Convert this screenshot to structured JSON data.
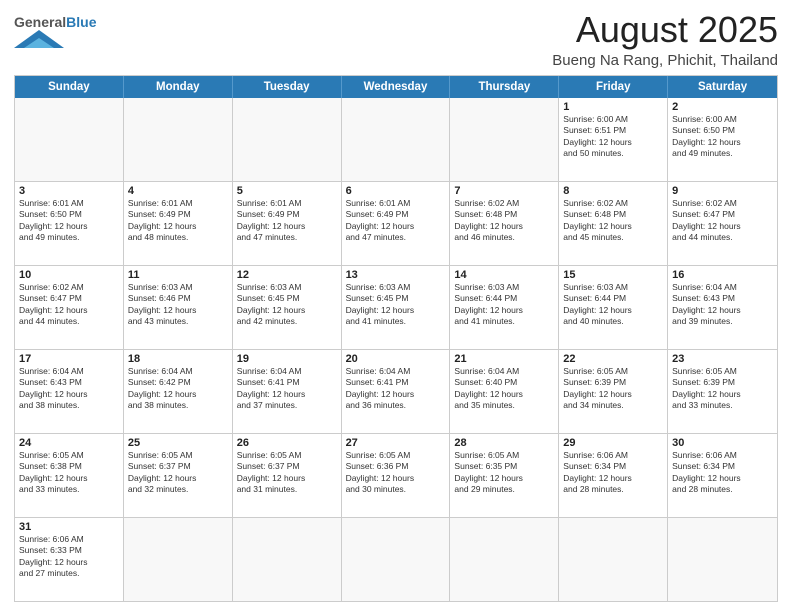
{
  "header": {
    "logo_general": "General",
    "logo_blue": "Blue",
    "month_year": "August 2025",
    "location": "Bueng Na Rang, Phichit, Thailand"
  },
  "weekdays": [
    "Sunday",
    "Monday",
    "Tuesday",
    "Wednesday",
    "Thursday",
    "Friday",
    "Saturday"
  ],
  "rows": [
    [
      {
        "day": "",
        "text": ""
      },
      {
        "day": "",
        "text": ""
      },
      {
        "day": "",
        "text": ""
      },
      {
        "day": "",
        "text": ""
      },
      {
        "day": "",
        "text": ""
      },
      {
        "day": "1",
        "text": "Sunrise: 6:00 AM\nSunset: 6:51 PM\nDaylight: 12 hours\nand 50 minutes."
      },
      {
        "day": "2",
        "text": "Sunrise: 6:00 AM\nSunset: 6:50 PM\nDaylight: 12 hours\nand 49 minutes."
      }
    ],
    [
      {
        "day": "3",
        "text": "Sunrise: 6:01 AM\nSunset: 6:50 PM\nDaylight: 12 hours\nand 49 minutes."
      },
      {
        "day": "4",
        "text": "Sunrise: 6:01 AM\nSunset: 6:49 PM\nDaylight: 12 hours\nand 48 minutes."
      },
      {
        "day": "5",
        "text": "Sunrise: 6:01 AM\nSunset: 6:49 PM\nDaylight: 12 hours\nand 47 minutes."
      },
      {
        "day": "6",
        "text": "Sunrise: 6:01 AM\nSunset: 6:49 PM\nDaylight: 12 hours\nand 47 minutes."
      },
      {
        "day": "7",
        "text": "Sunrise: 6:02 AM\nSunset: 6:48 PM\nDaylight: 12 hours\nand 46 minutes."
      },
      {
        "day": "8",
        "text": "Sunrise: 6:02 AM\nSunset: 6:48 PM\nDaylight: 12 hours\nand 45 minutes."
      },
      {
        "day": "9",
        "text": "Sunrise: 6:02 AM\nSunset: 6:47 PM\nDaylight: 12 hours\nand 44 minutes."
      }
    ],
    [
      {
        "day": "10",
        "text": "Sunrise: 6:02 AM\nSunset: 6:47 PM\nDaylight: 12 hours\nand 44 minutes."
      },
      {
        "day": "11",
        "text": "Sunrise: 6:03 AM\nSunset: 6:46 PM\nDaylight: 12 hours\nand 43 minutes."
      },
      {
        "day": "12",
        "text": "Sunrise: 6:03 AM\nSunset: 6:45 PM\nDaylight: 12 hours\nand 42 minutes."
      },
      {
        "day": "13",
        "text": "Sunrise: 6:03 AM\nSunset: 6:45 PM\nDaylight: 12 hours\nand 41 minutes."
      },
      {
        "day": "14",
        "text": "Sunrise: 6:03 AM\nSunset: 6:44 PM\nDaylight: 12 hours\nand 41 minutes."
      },
      {
        "day": "15",
        "text": "Sunrise: 6:03 AM\nSunset: 6:44 PM\nDaylight: 12 hours\nand 40 minutes."
      },
      {
        "day": "16",
        "text": "Sunrise: 6:04 AM\nSunset: 6:43 PM\nDaylight: 12 hours\nand 39 minutes."
      }
    ],
    [
      {
        "day": "17",
        "text": "Sunrise: 6:04 AM\nSunset: 6:43 PM\nDaylight: 12 hours\nand 38 minutes."
      },
      {
        "day": "18",
        "text": "Sunrise: 6:04 AM\nSunset: 6:42 PM\nDaylight: 12 hours\nand 38 minutes."
      },
      {
        "day": "19",
        "text": "Sunrise: 6:04 AM\nSunset: 6:41 PM\nDaylight: 12 hours\nand 37 minutes."
      },
      {
        "day": "20",
        "text": "Sunrise: 6:04 AM\nSunset: 6:41 PM\nDaylight: 12 hours\nand 36 minutes."
      },
      {
        "day": "21",
        "text": "Sunrise: 6:04 AM\nSunset: 6:40 PM\nDaylight: 12 hours\nand 35 minutes."
      },
      {
        "day": "22",
        "text": "Sunrise: 6:05 AM\nSunset: 6:39 PM\nDaylight: 12 hours\nand 34 minutes."
      },
      {
        "day": "23",
        "text": "Sunrise: 6:05 AM\nSunset: 6:39 PM\nDaylight: 12 hours\nand 33 minutes."
      }
    ],
    [
      {
        "day": "24",
        "text": "Sunrise: 6:05 AM\nSunset: 6:38 PM\nDaylight: 12 hours\nand 33 minutes."
      },
      {
        "day": "25",
        "text": "Sunrise: 6:05 AM\nSunset: 6:37 PM\nDaylight: 12 hours\nand 32 minutes."
      },
      {
        "day": "26",
        "text": "Sunrise: 6:05 AM\nSunset: 6:37 PM\nDaylight: 12 hours\nand 31 minutes."
      },
      {
        "day": "27",
        "text": "Sunrise: 6:05 AM\nSunset: 6:36 PM\nDaylight: 12 hours\nand 30 minutes."
      },
      {
        "day": "28",
        "text": "Sunrise: 6:05 AM\nSunset: 6:35 PM\nDaylight: 12 hours\nand 29 minutes."
      },
      {
        "day": "29",
        "text": "Sunrise: 6:06 AM\nSunset: 6:34 PM\nDaylight: 12 hours\nand 28 minutes."
      },
      {
        "day": "30",
        "text": "Sunrise: 6:06 AM\nSunset: 6:34 PM\nDaylight: 12 hours\nand 28 minutes."
      }
    ],
    [
      {
        "day": "31",
        "text": "Sunrise: 6:06 AM\nSunset: 6:33 PM\nDaylight: 12 hours\nand 27 minutes."
      },
      {
        "day": "",
        "text": ""
      },
      {
        "day": "",
        "text": ""
      },
      {
        "day": "",
        "text": ""
      },
      {
        "day": "",
        "text": ""
      },
      {
        "day": "",
        "text": ""
      },
      {
        "day": "",
        "text": ""
      }
    ]
  ]
}
